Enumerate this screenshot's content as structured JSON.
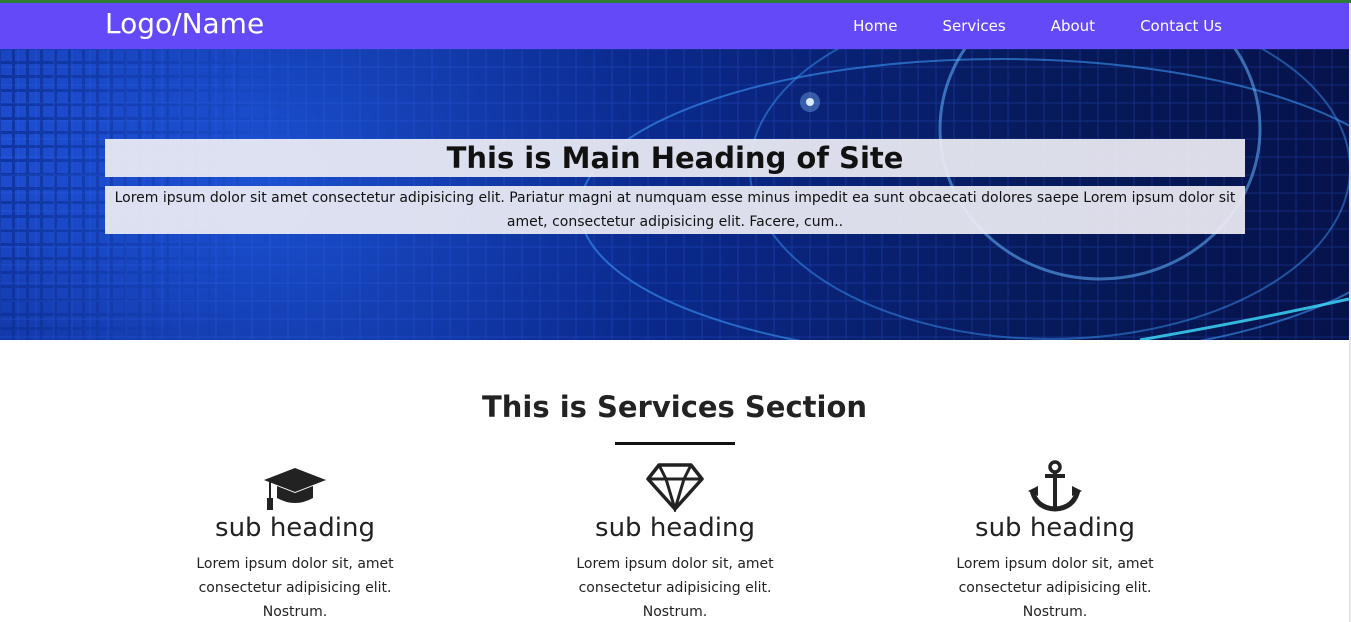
{
  "header": {
    "logo": "Logo/Name",
    "nav": [
      "Home",
      "Services",
      "About",
      "Contact Us"
    ],
    "background_color": "#6349f7"
  },
  "hero": {
    "heading": "This is Main Heading of Site",
    "text": "Lorem ipsum dolor sit amet consectetur adipisicing elit. Pariatur magni at numquam esse minus impedit ea sunt obcaecati dolores saepe Lorem ipsum dolor sit amet, consectetur adipisicing elit. Facere, cum.."
  },
  "services": {
    "title": "This is Services Section",
    "items": [
      {
        "icon": "graduation-cap-icon",
        "heading": "sub heading",
        "text": "Lorem ipsum dolor sit, amet consectetur adipisicing elit. Nostrum."
      },
      {
        "icon": "diamond-icon",
        "heading": "sub heading",
        "text": "Lorem ipsum dolor sit, amet consectetur adipisicing elit. Nostrum."
      },
      {
        "icon": "anchor-icon",
        "heading": "sub heading",
        "text": "Lorem ipsum dolor sit, amet consectetur adipisicing elit. Nostrum."
      }
    ]
  }
}
